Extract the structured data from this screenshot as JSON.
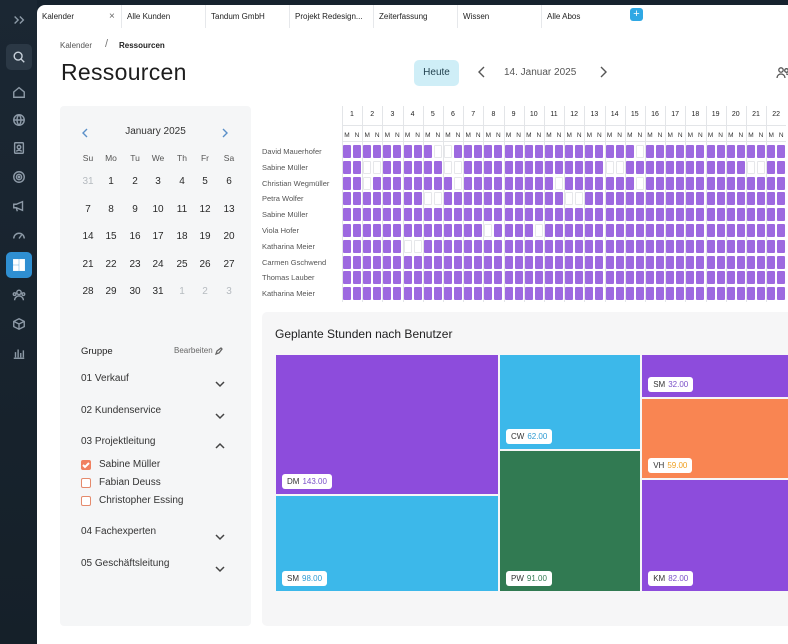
{
  "tabs": [
    "Kalender",
    "Alle Kunden",
    "Tandum GmbH",
    "Projekt Redesign...",
    "Zeiterfassung",
    "Wissen",
    "Alle Abos"
  ],
  "tab_close": "×",
  "tab_add": "+",
  "breadcrumb": {
    "parent": "Kalender",
    "separator": "/",
    "current": "Ressourcen"
  },
  "page_title": "Ressourcen",
  "toolbar": {
    "today_label": "Heute",
    "date": "14. Januar 2025"
  },
  "calendar": {
    "month": "January 2025",
    "weekdays": [
      "Su",
      "Mo",
      "Tu",
      "We",
      "Th",
      "Fr",
      "Sa"
    ],
    "weeks": [
      [
        "31",
        "1",
        "2",
        "3",
        "4",
        "5",
        "6"
      ],
      [
        "7",
        "8",
        "9",
        "10",
        "11",
        "12",
        "13"
      ],
      [
        "14",
        "15",
        "16",
        "17",
        "18",
        "19",
        "20"
      ],
      [
        "21",
        "22",
        "23",
        "24",
        "25",
        "26",
        "27"
      ],
      [
        "28",
        "29",
        "30",
        "31",
        "1",
        "2",
        "3"
      ]
    ]
  },
  "groups": {
    "title": "Gruppe",
    "edit_label": "Bearbeiten",
    "items": [
      {
        "label": "01 Verkauf",
        "expanded": false
      },
      {
        "label": "02 Kundenservice",
        "expanded": false
      },
      {
        "label": "03 Projektleitung",
        "expanded": true,
        "members": [
          {
            "name": "Sabine Müller",
            "checked": true
          },
          {
            "name": "Fabian Deuss",
            "checked": false
          },
          {
            "name": "Christopher Essing",
            "checked": false
          }
        ]
      },
      {
        "label": "04 Fachexperten",
        "expanded": false
      },
      {
        "label": "05 Geschäftsleitung",
        "expanded": false
      }
    ]
  },
  "schedule": {
    "days": [
      "1",
      "2",
      "3",
      "4",
      "5",
      "6",
      "7",
      "8",
      "9",
      "10",
      "11",
      "12",
      "13",
      "14",
      "15",
      "16",
      "17",
      "18",
      "19",
      "20",
      "21",
      "22"
    ],
    "half_labels": [
      "M",
      "N"
    ],
    "employees": [
      {
        "name": "David Mauerhofer",
        "booked": "11111111100111111111111111111011111111111111"
      },
      {
        "name": "Sabine Müller",
        "booked": "11001111110011111111111111001111111111110011"
      },
      {
        "name": "Christian Wegmüller",
        "booked": "11011111111011111111101111111011111111111111"
      },
      {
        "name": "Petra Wolfer",
        "booked": "11111111001111111111110011111111111111111111"
      },
      {
        "name": "Sabine Müller",
        "booked": "11111111111111111111111111111111111111111111"
      },
      {
        "name": "Viola Hofer",
        "booked": "11111111111111011110111111111111111111111111"
      },
      {
        "name": "Katharina Meier",
        "booked": "11111100111111111111111111111111111111111111"
      },
      {
        "name": "Carmen Gschwend",
        "booked": "11111111111111111111111111111111111111111111"
      },
      {
        "name": "Thomas Lauber",
        "booked": "11111111111111111111111111111111111111111111"
      },
      {
        "name": "Katharina Meier",
        "booked": "11111111111111111111111111111111111111111111"
      }
    ],
    "color": "#9d69e0"
  },
  "chart_data": {
    "type": "treemap",
    "title": "Geplante Stunden nach Benutzer",
    "items": [
      {
        "label": "DM",
        "value": 143.0,
        "color": "#8d4cdc"
      },
      {
        "label": "SM",
        "value": 98.0,
        "color": "#3cb8ea"
      },
      {
        "label": "CW",
        "value": 62.0,
        "color": "#3cb8ea"
      },
      {
        "label": "PW",
        "value": 91.0,
        "color": "#317a52"
      },
      {
        "label": "SM",
        "value": 32.0,
        "color": "#8d4cdc"
      },
      {
        "label": "VH",
        "value": 59.0,
        "color": "#f98552"
      },
      {
        "label": "KM",
        "value": 82.0,
        "color": "#8d4cdc"
      }
    ],
    "value_text": [
      "143.00",
      "98.00",
      "62.00",
      "91.00",
      "32.00",
      "59.00",
      "82.00"
    ],
    "label_value_colors": [
      "#7a4fc8",
      "#2e9bd3",
      "#2e9bd3",
      "#317a52",
      "#7a4fc8",
      "#f0a020",
      "#7a4fc8"
    ]
  }
}
